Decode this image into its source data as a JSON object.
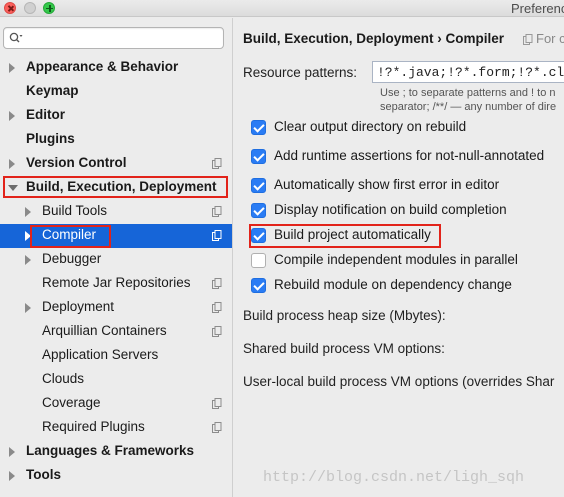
{
  "window": {
    "title": "Preferences"
  },
  "sidebar": {
    "search": {
      "value": "",
      "placeholder": ""
    },
    "items": [
      {
        "label": "Appearance & Behavior",
        "bold": true,
        "level": 0,
        "arrow": "right",
        "copy": false,
        "selected": false
      },
      {
        "label": "Keymap",
        "bold": true,
        "level": 0,
        "arrow": "none",
        "copy": false,
        "selected": false
      },
      {
        "label": "Editor",
        "bold": true,
        "level": 0,
        "arrow": "right",
        "copy": false,
        "selected": false
      },
      {
        "label": "Plugins",
        "bold": true,
        "level": 0,
        "arrow": "none",
        "copy": false,
        "selected": false
      },
      {
        "label": "Version Control",
        "bold": true,
        "level": 0,
        "arrow": "right",
        "copy": true,
        "selected": false
      },
      {
        "label": "Build, Execution, Deployment",
        "bold": true,
        "level": 0,
        "arrow": "down",
        "copy": false,
        "selected": false
      },
      {
        "label": "Build Tools",
        "bold": false,
        "level": 1,
        "arrow": "right",
        "copy": true,
        "selected": false
      },
      {
        "label": "Compiler",
        "bold": false,
        "level": 1,
        "arrow": "right",
        "copy": true,
        "selected": true
      },
      {
        "label": "Debugger",
        "bold": false,
        "level": 1,
        "arrow": "right",
        "copy": false,
        "selected": false
      },
      {
        "label": "Remote Jar Repositories",
        "bold": false,
        "level": 1,
        "arrow": "none",
        "copy": true,
        "selected": false
      },
      {
        "label": "Deployment",
        "bold": false,
        "level": 1,
        "arrow": "right",
        "copy": true,
        "selected": false
      },
      {
        "label": "Arquillian Containers",
        "bold": false,
        "level": 1,
        "arrow": "none",
        "copy": true,
        "selected": false
      },
      {
        "label": "Application Servers",
        "bold": false,
        "level": 1,
        "arrow": "none",
        "copy": false,
        "selected": false
      },
      {
        "label": "Clouds",
        "bold": false,
        "level": 1,
        "arrow": "none",
        "copy": false,
        "selected": false
      },
      {
        "label": "Coverage",
        "bold": false,
        "level": 1,
        "arrow": "none",
        "copy": true,
        "selected": false
      },
      {
        "label": "Required Plugins",
        "bold": false,
        "level": 1,
        "arrow": "none",
        "copy": true,
        "selected": false
      },
      {
        "label": "Languages & Frameworks",
        "bold": true,
        "level": 0,
        "arrow": "right",
        "copy": false,
        "selected": false
      },
      {
        "label": "Tools",
        "bold": true,
        "level": 0,
        "arrow": "right",
        "copy": false,
        "selected": false
      }
    ]
  },
  "main": {
    "breadcrumb": "Build, Execution, Deployment › Compiler",
    "breadcrumb_note": "For c",
    "resource_patterns": {
      "label": "Resource patterns:",
      "value": "!?*.java;!?*.form;!?*.cl"
    },
    "hint_line1": "Use ; to separate patterns and ! to n",
    "hint_line2": "separator; /**/ — any number of dire",
    "options": [
      {
        "label": "Clear output directory on rebuild",
        "checked": true
      },
      {
        "label": "Add runtime assertions for not-null-annotated",
        "checked": true
      },
      {
        "label": "Automatically show first error in editor",
        "checked": true
      },
      {
        "label": "Display notification on build completion",
        "checked": true
      },
      {
        "label": "Build project automatically",
        "checked": true
      },
      {
        "label": "Compile independent modules in parallel",
        "checked": false
      },
      {
        "label": "Rebuild module on dependency change",
        "checked": true
      }
    ],
    "heap_size_label": "Build process heap size (Mbytes):",
    "shared_vm_label": "Shared build process VM options:",
    "user_vm_label": "User-local build process VM options (overrides Shar",
    "watermark": "http://blog.csdn.net/ligh_sqh"
  },
  "colors": {
    "selection": "#1665d8",
    "checkbox": "#2a7cf4",
    "highlight_box": "#e2231a"
  }
}
